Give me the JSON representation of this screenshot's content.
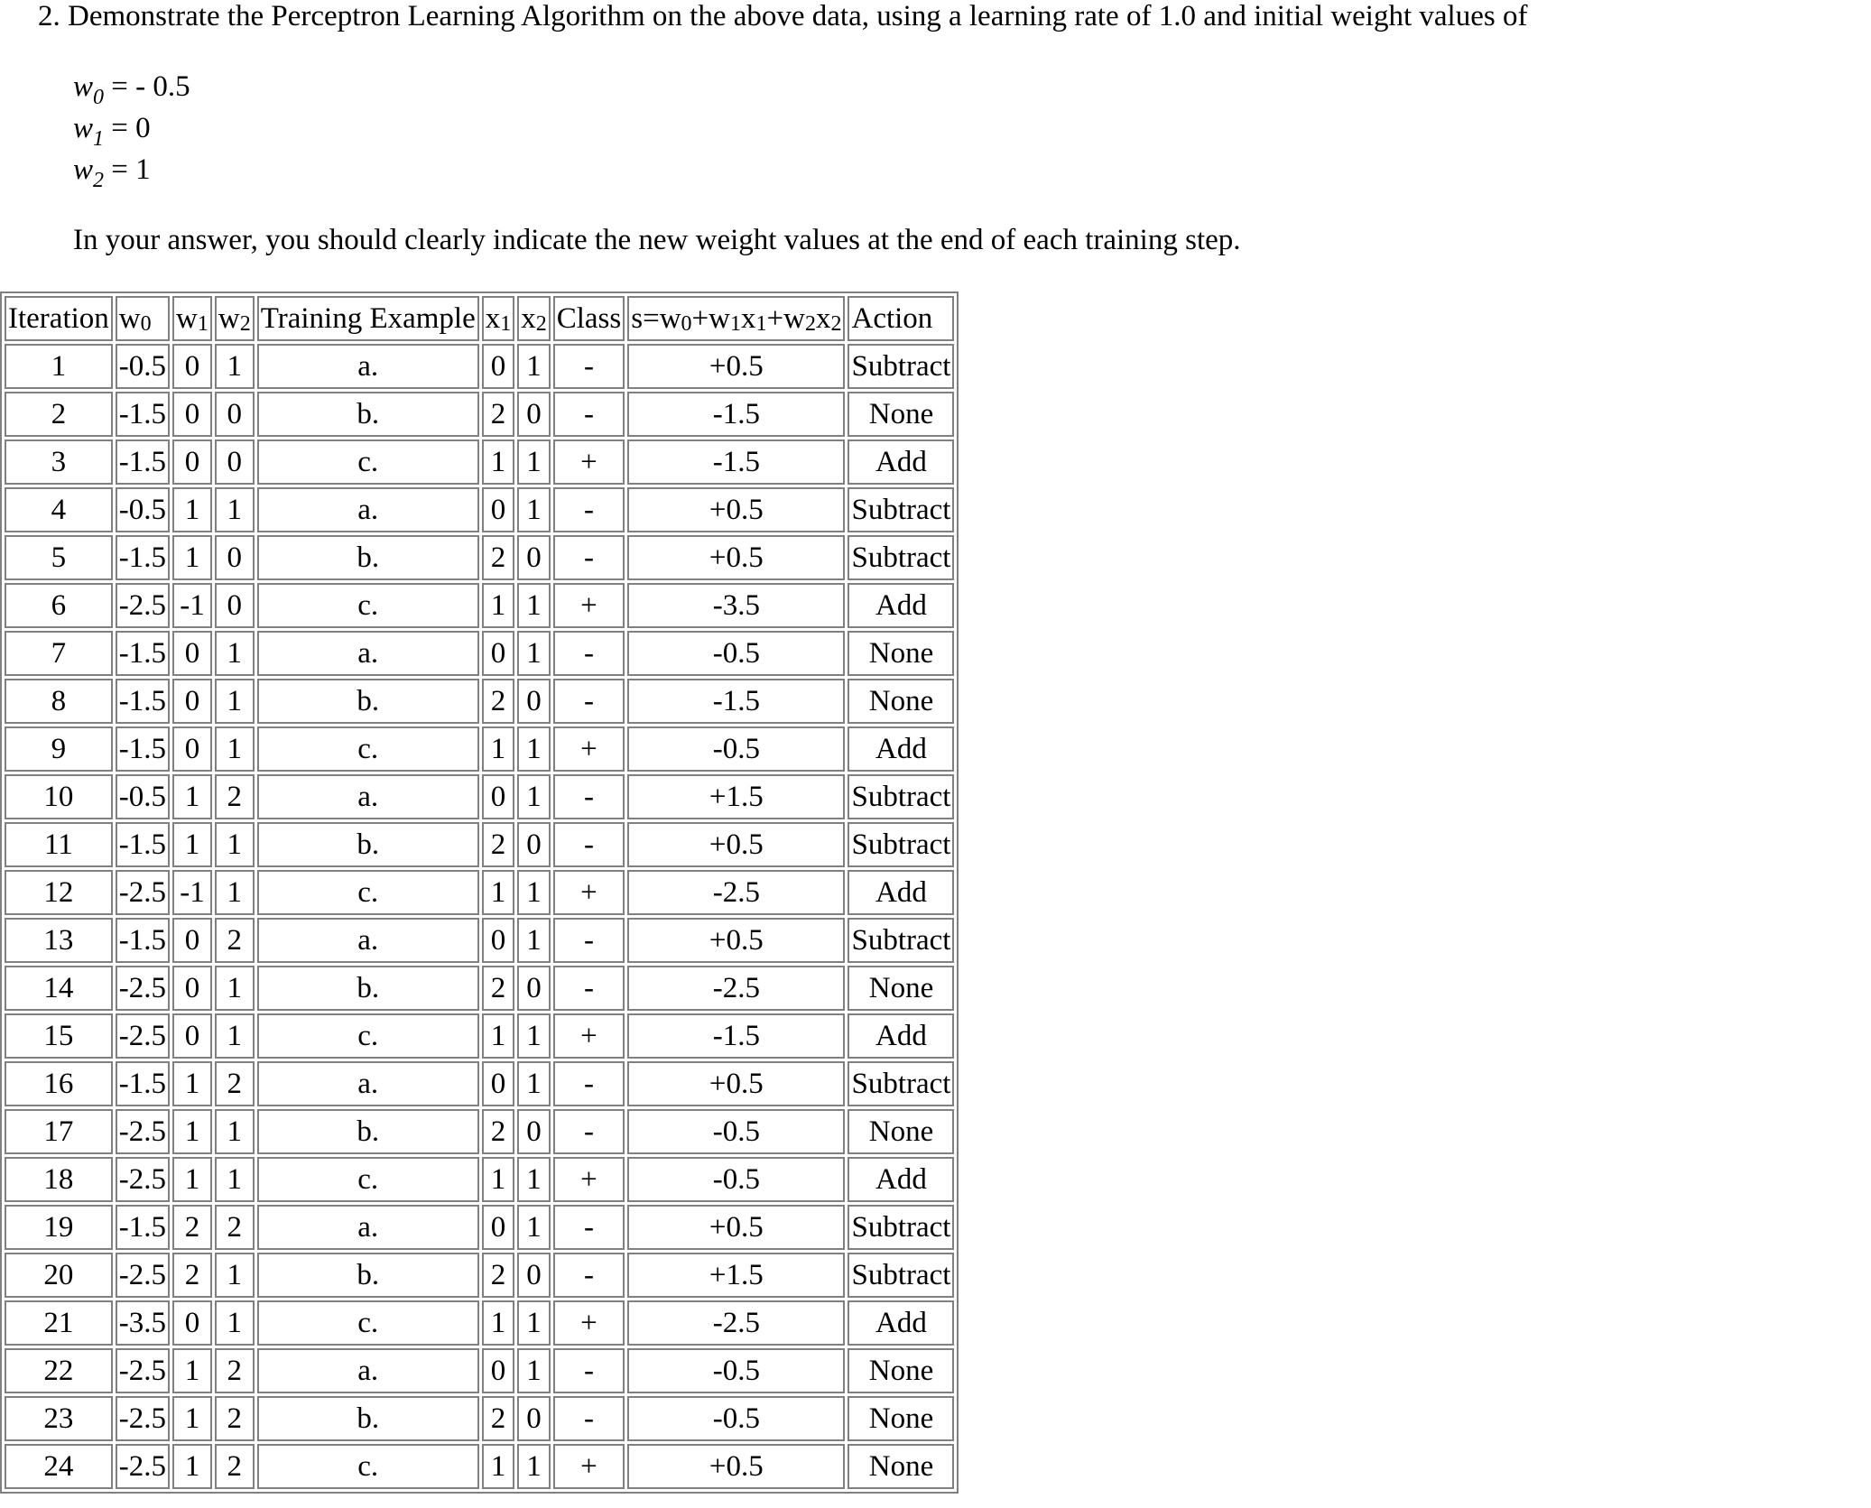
{
  "question": "2. Demonstrate the Perceptron Learning Algorithm on the above data, using a learning rate of 1.0 and initial weight values of",
  "weights": [
    {
      "var": "w",
      "sub": "0",
      "eq": " = - 0.5"
    },
    {
      "var": "w",
      "sub": "1",
      "eq": " = 0"
    },
    {
      "var": "w",
      "sub": "2",
      "eq": " = 1"
    }
  ],
  "instruction": "In your answer, you should clearly indicate the new weight values at the end of each training step.",
  "table": {
    "headers": [
      "Iteration",
      "w0",
      "w1",
      "w2",
      "Training Example",
      "x1",
      "x2",
      "Class",
      "s=w0+w1x1+w2x2",
      "Action"
    ],
    "rows": [
      [
        "1",
        "-0.5",
        "0",
        "1",
        "a.",
        "0",
        "1",
        "-",
        "+0.5",
        "Subtract"
      ],
      [
        "2",
        "-1.5",
        "0",
        "0",
        "b.",
        "2",
        "0",
        "-",
        "-1.5",
        "None"
      ],
      [
        "3",
        "-1.5",
        "0",
        "0",
        "c.",
        "1",
        "1",
        "+",
        "-1.5",
        "Add"
      ],
      [
        "4",
        "-0.5",
        "1",
        "1",
        "a.",
        "0",
        "1",
        "-",
        "+0.5",
        "Subtract"
      ],
      [
        "5",
        "-1.5",
        "1",
        "0",
        "b.",
        "2",
        "0",
        "-",
        "+0.5",
        "Subtract"
      ],
      [
        "6",
        "-2.5",
        "-1",
        "0",
        "c.",
        "1",
        "1",
        "+",
        "-3.5",
        "Add"
      ],
      [
        "7",
        "-1.5",
        "0",
        "1",
        "a.",
        "0",
        "1",
        "-",
        "-0.5",
        "None"
      ],
      [
        "8",
        "-1.5",
        "0",
        "1",
        "b.",
        "2",
        "0",
        "-",
        "-1.5",
        "None"
      ],
      [
        "9",
        "-1.5",
        "0",
        "1",
        "c.",
        "1",
        "1",
        "+",
        "-0.5",
        "Add"
      ],
      [
        "10",
        "-0.5",
        "1",
        "2",
        "a.",
        "0",
        "1",
        "-",
        "+1.5",
        "Subtract"
      ],
      [
        "11",
        "-1.5",
        "1",
        "1",
        "b.",
        "2",
        "0",
        "-",
        "+0.5",
        "Subtract"
      ],
      [
        "12",
        "-2.5",
        "-1",
        "1",
        "c.",
        "1",
        "1",
        "+",
        "-2.5",
        "Add"
      ],
      [
        "13",
        "-1.5",
        "0",
        "2",
        "a.",
        "0",
        "1",
        "-",
        "+0.5",
        "Subtract"
      ],
      [
        "14",
        "-2.5",
        "0",
        "1",
        "b.",
        "2",
        "0",
        "-",
        "-2.5",
        "None"
      ],
      [
        "15",
        "-2.5",
        "0",
        "1",
        "c.",
        "1",
        "1",
        "+",
        "-1.5",
        "Add"
      ],
      [
        "16",
        "-1.5",
        "1",
        "2",
        "a.",
        "0",
        "1",
        "-",
        "+0.5",
        "Subtract"
      ],
      [
        "17",
        "-2.5",
        "1",
        "1",
        "b.",
        "2",
        "0",
        "-",
        "-0.5",
        "None"
      ],
      [
        "18",
        "-2.5",
        "1",
        "1",
        "c.",
        "1",
        "1",
        "+",
        "-0.5",
        "Add"
      ],
      [
        "19",
        "-1.5",
        "2",
        "2",
        "a.",
        "0",
        "1",
        "-",
        "+0.5",
        "Subtract"
      ],
      [
        "20",
        "-2.5",
        "2",
        "1",
        "b.",
        "2",
        "0",
        "-",
        "+1.5",
        "Subtract"
      ],
      [
        "21",
        "-3.5",
        "0",
        "1",
        "c.",
        "1",
        "1",
        "+",
        "-2.5",
        "Add"
      ],
      [
        "22",
        "-2.5",
        "1",
        "2",
        "a.",
        "0",
        "1",
        "-",
        "-0.5",
        "None"
      ],
      [
        "23",
        "-2.5",
        "1",
        "2",
        "b.",
        "2",
        "0",
        "-",
        "-0.5",
        "None"
      ],
      [
        "24",
        "-2.5",
        "1",
        "2",
        "c.",
        "1",
        "1",
        "+",
        "+0.5",
        "None"
      ]
    ]
  }
}
